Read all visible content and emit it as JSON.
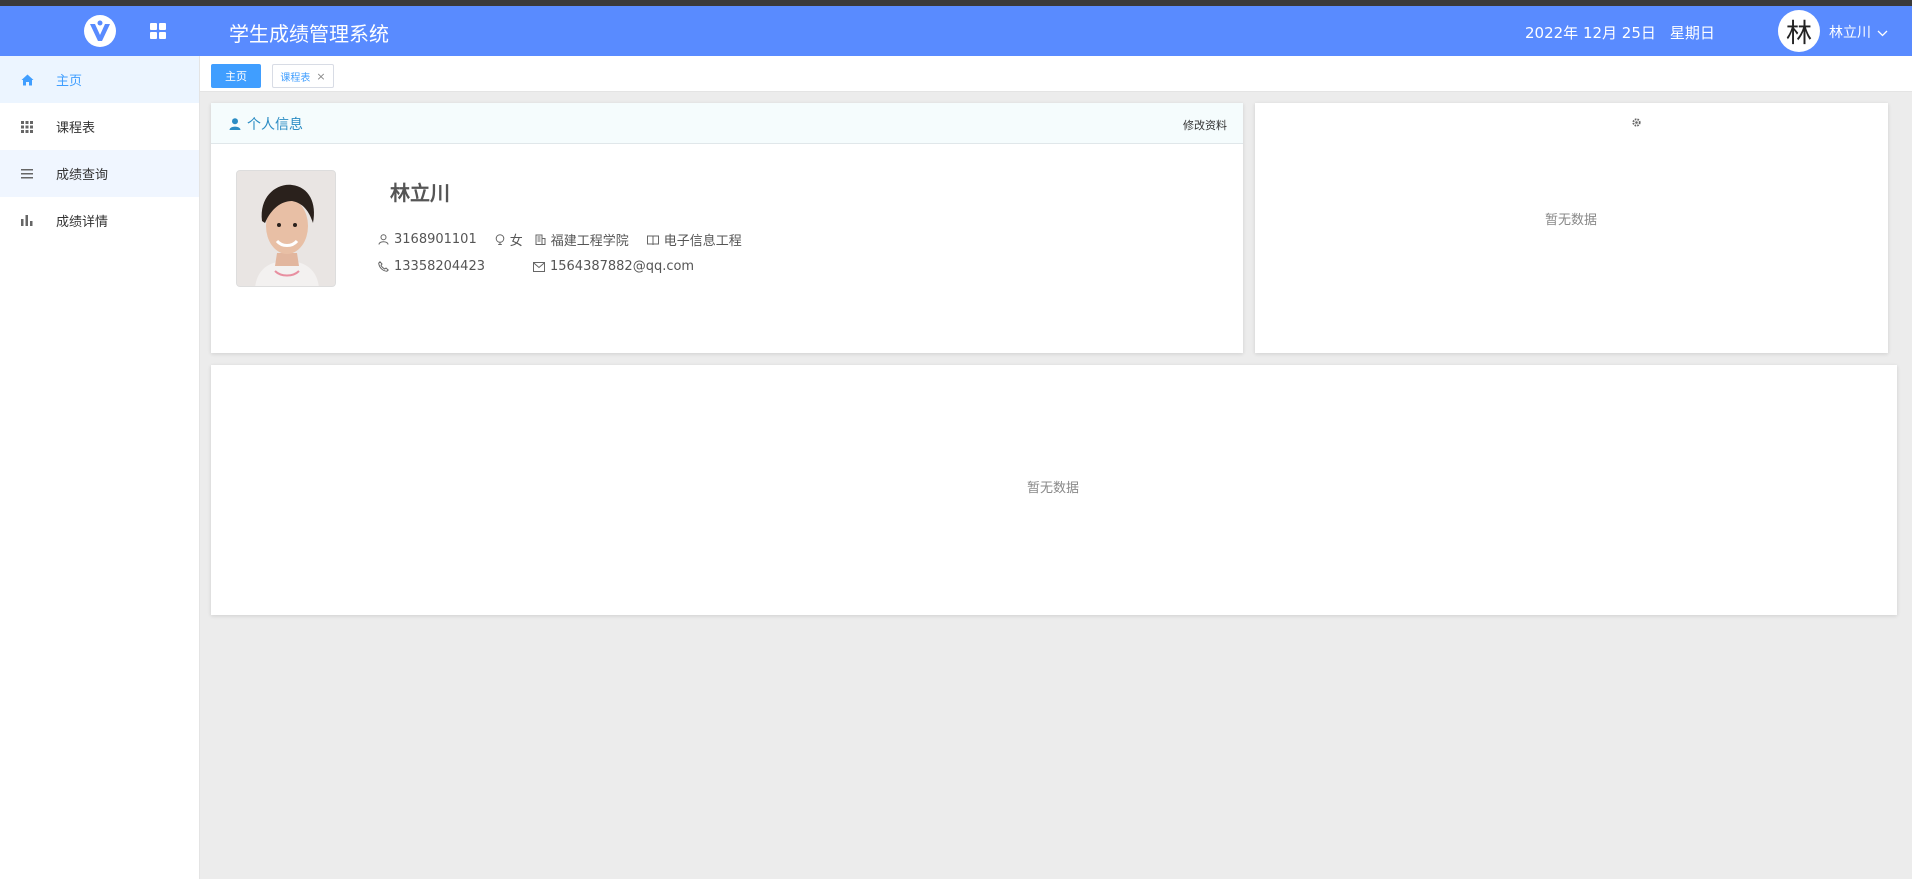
{
  "header": {
    "title": "学生成绩管理系统",
    "date": "2022年 12月 25日",
    "weekday": "星期日",
    "avatar_char": "林",
    "user_name": "林立川"
  },
  "sidebar": {
    "items": [
      {
        "label": "主页",
        "icon": "home-icon"
      },
      {
        "label": "课程表",
        "icon": "grid-icon"
      },
      {
        "label": "成绩查询",
        "icon": "list-icon"
      },
      {
        "label": "成绩详情",
        "icon": "bar-chart-icon"
      }
    ]
  },
  "tabs": {
    "home": "主页",
    "course": "课程表",
    "close": "×"
  },
  "info_card": {
    "title": "个人信息",
    "edit_label": "修改资料",
    "name": "林立川",
    "student_id": "3168901101",
    "gender": "女",
    "college": "福建工程学院",
    "major": "电子信息工程",
    "phone": "13358204423",
    "email": "1564387882@qq.com"
  },
  "right_card": {
    "empty_text": "暂无数据"
  },
  "bottom_card": {
    "empty_text": "暂无数据"
  },
  "colors": {
    "header": "#598bff",
    "accent": "#409eff",
    "card_title": "#2b8cc4"
  }
}
